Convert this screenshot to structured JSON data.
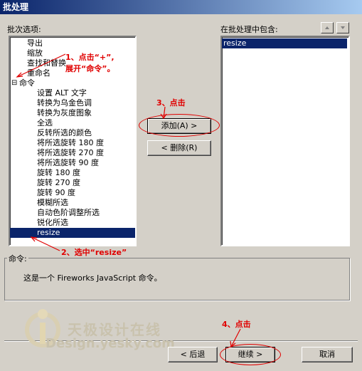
{
  "window": {
    "title": "批处理"
  },
  "left_panel": {
    "label": "批次选项:",
    "items": [
      {
        "label": "导出",
        "indent": 1,
        "expander": ""
      },
      {
        "label": "缩放",
        "indent": 1,
        "expander": ""
      },
      {
        "label": "查找和替换",
        "indent": 1,
        "expander": ""
      },
      {
        "label": "重命名",
        "indent": 1,
        "expander": ""
      },
      {
        "label": "命令",
        "indent": 0,
        "expander": "⊟"
      },
      {
        "label": "设置 ALT 文字",
        "indent": 2,
        "expander": ""
      },
      {
        "label": "转换为乌金色调",
        "indent": 2,
        "expander": ""
      },
      {
        "label": "转换为灰度图象",
        "indent": 2,
        "expander": ""
      },
      {
        "label": "全选",
        "indent": 2,
        "expander": ""
      },
      {
        "label": "反转所选的颜色",
        "indent": 2,
        "expander": ""
      },
      {
        "label": "将所选旋转 180 度",
        "indent": 2,
        "expander": ""
      },
      {
        "label": "将所选旋转 270 度",
        "indent": 2,
        "expander": ""
      },
      {
        "label": "将所选旋转 90 度",
        "indent": 2,
        "expander": ""
      },
      {
        "label": "旋转 180 度",
        "indent": 2,
        "expander": ""
      },
      {
        "label": "旋转 270 度",
        "indent": 2,
        "expander": ""
      },
      {
        "label": "旋转 90 度",
        "indent": 2,
        "expander": ""
      },
      {
        "label": "模糊所选",
        "indent": 2,
        "expander": ""
      },
      {
        "label": "自动色阶调整所选",
        "indent": 2,
        "expander": ""
      },
      {
        "label": "锐化所选",
        "indent": 2,
        "expander": ""
      },
      {
        "label": "resize",
        "indent": 2,
        "expander": "",
        "selected": true
      }
    ]
  },
  "right_panel": {
    "label": "在批处理中包含:",
    "items": [
      {
        "label": "resize",
        "selected": true
      }
    ],
    "move_up_icon": "triangle-up-icon",
    "move_down_icon": "triangle-down-icon"
  },
  "buttons": {
    "add": "添加(A) >",
    "remove": "< 删除(R)",
    "back": "< 后退",
    "continue": "继续 >",
    "cancel": "取消"
  },
  "description": {
    "group_label": "命令:",
    "text": "这是一个 Fireworks JavaScript 命令。"
  },
  "annotations": {
    "step1_line1": "1、点击“+”,",
    "step1_line2": "展开“命令”。",
    "step2": "2、选中“resize”",
    "step3": "3、点击",
    "step4": "4、点击",
    "color": "#e00000"
  },
  "watermark": {
    "cn": "天极设计在线",
    "en": "Design.yesky.com"
  }
}
